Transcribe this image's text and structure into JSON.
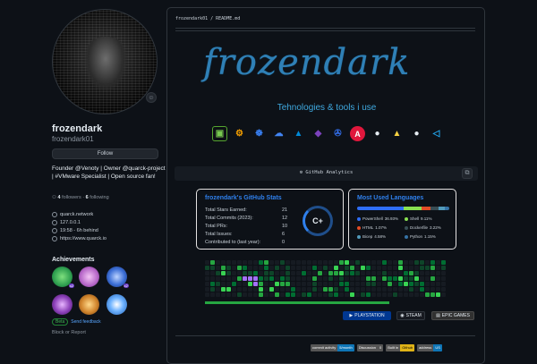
{
  "profile": {
    "display_name": "frozendark",
    "username": "frozendark01",
    "follow_label": "Follow",
    "bio": "Founder @Venoty | Owner @quarck-project | #VMware Specialist | Open source fan!",
    "followers_count": "4",
    "followers_label": "followers",
    "following_count": "6",
    "following_label": "following",
    "meta": [
      {
        "icon": "organization-icon",
        "text": "quarck.network"
      },
      {
        "icon": "location-icon",
        "text": "127.0.0.1"
      },
      {
        "icon": "clock-icon",
        "text": "19:58 - 6h behind"
      },
      {
        "icon": "link-icon",
        "text": "https://www.quarck.io"
      }
    ],
    "achievements_title": "Achievements",
    "beta_label": "Beta",
    "feedback_label": "Send feedback",
    "block_label": "Block or Report"
  },
  "readme": {
    "path": "frozendark01 / README.md",
    "banner_text": "frozendark",
    "subtitle": "Tehnologies & tools i use",
    "stats_bar_label": "GitHub Analytics"
  },
  "github_stats": {
    "title": "frozendark's GitHub Stats",
    "rows": [
      {
        "label": "Total Stars Earned:",
        "value": "21"
      },
      {
        "label": "Total Commits (2023):",
        "value": "12"
      },
      {
        "label": "Total PRs:",
        "value": "10"
      },
      {
        "label": "Total Issues:",
        "value": "6"
      },
      {
        "label": "Contributed to (last year):",
        "value": "0"
      }
    ],
    "grade": "C+"
  },
  "languages": {
    "title": "Most Used Languages",
    "items": [
      {
        "name": "PowerShell",
        "pct": "36.93%",
        "color": "#2f6ef7"
      },
      {
        "name": "Shell",
        "pct": "9.11%",
        "color": "#89e051"
      },
      {
        "name": "HTML",
        "pct": "1.07%",
        "color": "#e34c26"
      },
      {
        "name": "Dockerfile",
        "pct": "3.22%",
        "color": "#384d54"
      },
      {
        "name": "Bicep",
        "pct": "4.58%",
        "color": "#519aba"
      },
      {
        "name": "Python",
        "pct": "1.15%",
        "color": "#3572a5"
      }
    ]
  },
  "game_badges": [
    {
      "label": "PLAYSTATION",
      "bg": "#003791"
    },
    {
      "label": "STEAM",
      "bg": "#171a21"
    },
    {
      "label": "EPIC GAMES",
      "bg": "#313131"
    }
  ],
  "footer_badges": [
    {
      "left": "commit activity",
      "right": "5/month",
      "color": "#0e75b6"
    },
    {
      "left": "Discussion",
      "right": "0",
      "color": "#555"
    },
    {
      "left": "Built in",
      "right": "Github",
      "color": "#dfb317"
    },
    {
      "left": "address",
      "right": "US",
      "color": "#0e75b6"
    }
  ]
}
